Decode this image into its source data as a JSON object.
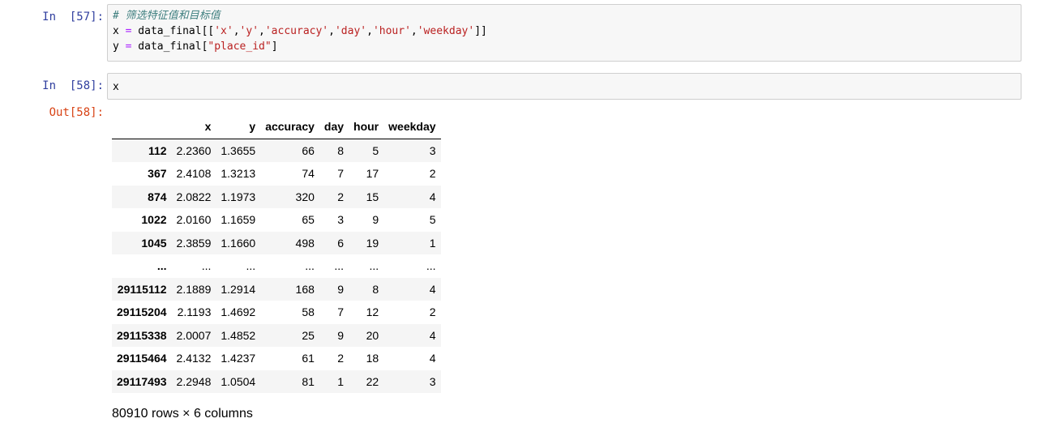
{
  "cells": {
    "c57": {
      "prompt": "In  [57]:",
      "lines": [
        [
          {
            "t": "# 筛选特征值和目标值",
            "c": "cm"
          }
        ],
        [
          {
            "t": "x ",
            "c": ""
          },
          {
            "t": "=",
            "c": "op"
          },
          {
            "t": " data_final[[",
            "c": ""
          },
          {
            "t": "'x'",
            "c": "st"
          },
          {
            "t": ",",
            "c": ""
          },
          {
            "t": "'y'",
            "c": "st"
          },
          {
            "t": ",",
            "c": ""
          },
          {
            "t": "'accuracy'",
            "c": "st"
          },
          {
            "t": ",",
            "c": ""
          },
          {
            "t": "'day'",
            "c": "st"
          },
          {
            "t": ",",
            "c": ""
          },
          {
            "t": "'hour'",
            "c": "st"
          },
          {
            "t": ",",
            "c": ""
          },
          {
            "t": "'weekday'",
            "c": "st"
          },
          {
            "t": "]]",
            "c": ""
          }
        ],
        [
          {
            "t": "y ",
            "c": ""
          },
          {
            "t": "=",
            "c": "op"
          },
          {
            "t": " data_final[",
            "c": ""
          },
          {
            "t": "\"place_id\"",
            "c": "st"
          },
          {
            "t": "]",
            "c": ""
          }
        ]
      ]
    },
    "c58": {
      "prompt": "In  [58]:",
      "out_prompt": "Out[58]:",
      "code": "x"
    }
  },
  "dataframe": {
    "columns": [
      "",
      "x",
      "y",
      "accuracy",
      "day",
      "hour",
      "weekday"
    ],
    "rows": [
      [
        "112",
        "2.2360",
        "1.3655",
        "66",
        "8",
        "5",
        "3"
      ],
      [
        "367",
        "2.4108",
        "1.3213",
        "74",
        "7",
        "17",
        "2"
      ],
      [
        "874",
        "2.0822",
        "1.1973",
        "320",
        "2",
        "15",
        "4"
      ],
      [
        "1022",
        "2.0160",
        "1.1659",
        "65",
        "3",
        "9",
        "5"
      ],
      [
        "1045",
        "2.3859",
        "1.1660",
        "498",
        "6",
        "19",
        "1"
      ],
      [
        "...",
        "...",
        "...",
        "...",
        "...",
        "...",
        "..."
      ],
      [
        "29115112",
        "2.1889",
        "1.2914",
        "168",
        "9",
        "8",
        "4"
      ],
      [
        "29115204",
        "2.1193",
        "1.4692",
        "58",
        "7",
        "12",
        "2"
      ],
      [
        "29115338",
        "2.0007",
        "1.4852",
        "25",
        "9",
        "20",
        "4"
      ],
      [
        "29115464",
        "2.4132",
        "1.4237",
        "61",
        "2",
        "18",
        "4"
      ],
      [
        "29117493",
        "2.2948",
        "1.0504",
        "81",
        "1",
        "22",
        "3"
      ]
    ],
    "shape_text": "80910 rows × 6 columns"
  }
}
